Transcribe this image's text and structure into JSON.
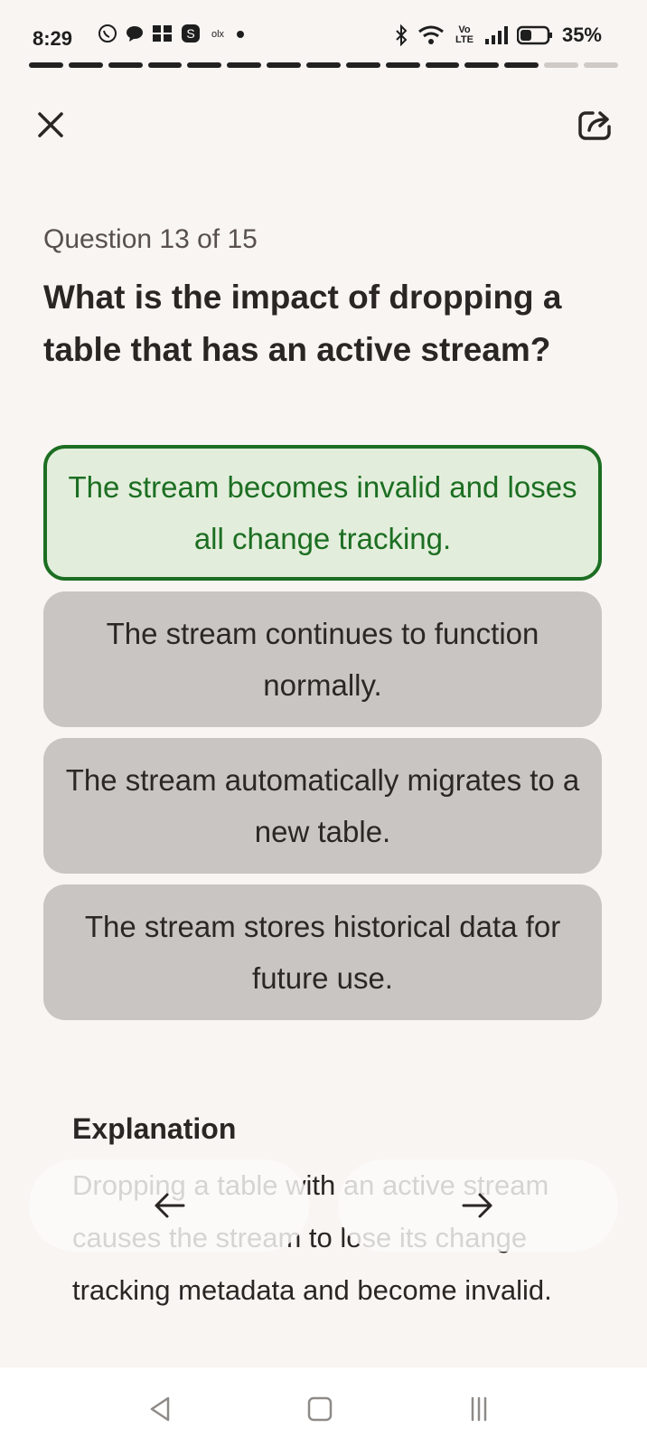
{
  "status_bar": {
    "time": "8:29",
    "network_label": "Vo LTE",
    "battery": "35%"
  },
  "progress": {
    "total_segments": 15,
    "completed_segments": 13
  },
  "quiz": {
    "question_counter": "Question 13 of 15",
    "question": "What is the impact of dropping a table that has an active stream?",
    "options": [
      {
        "text": "The stream becomes invalid and loses all change tracking.",
        "state": "correct"
      },
      {
        "text": "The stream continues to function normally.",
        "state": "default"
      },
      {
        "text": "The stream automatically migrates to a new table.",
        "state": "default"
      },
      {
        "text": "The stream stores historical data for future use.",
        "state": "default"
      }
    ],
    "explanation_title": "Explanation",
    "explanation_body": "Dropping a table with an active stream causes the stream to lose its change tracking metadata and become invalid."
  },
  "colors": {
    "correct_green": "#1c6e22",
    "correct_bg": "#e2eedb",
    "option_bg": "#c9c5c2",
    "page_bg": "#f8f5f2"
  },
  "icons": {
    "close": "close-icon",
    "share": "share-icon",
    "prev": "arrow-left-icon",
    "next": "arrow-right-icon"
  }
}
